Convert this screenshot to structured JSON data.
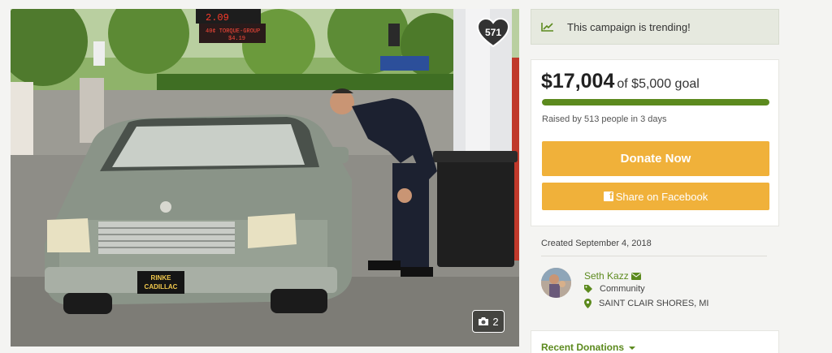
{
  "photo": {
    "hearts_count": "571",
    "gallery_count": "2",
    "scene_signs": {
      "gas_price_top": "2.09",
      "gas_sign": "40¢ TORQUE-GROUP",
      "gas_sign_sub": "$4.19",
      "plate_line1": "RINKE",
      "plate_line2": "CADILLAC"
    }
  },
  "trending": {
    "text": "This campaign is trending!"
  },
  "campaign": {
    "amount": "$17,004",
    "goal": "of $5,000 goal",
    "progress_percent": 100,
    "raised_text": "Raised by 513 people in 3 days",
    "donate_label": "Donate Now",
    "share_label": "Share on Facebook",
    "created": "Created September 4, 2018"
  },
  "organizer": {
    "name": "Seth Kazz",
    "category": "Community",
    "location": "SAINT CLAIR SHORES, MI"
  },
  "recent_donations": {
    "label": "Recent Donations"
  },
  "colors": {
    "accent_green": "#5c8a1e",
    "button_orange": "#f0b13a",
    "trending_bg": "#e6e9df"
  }
}
